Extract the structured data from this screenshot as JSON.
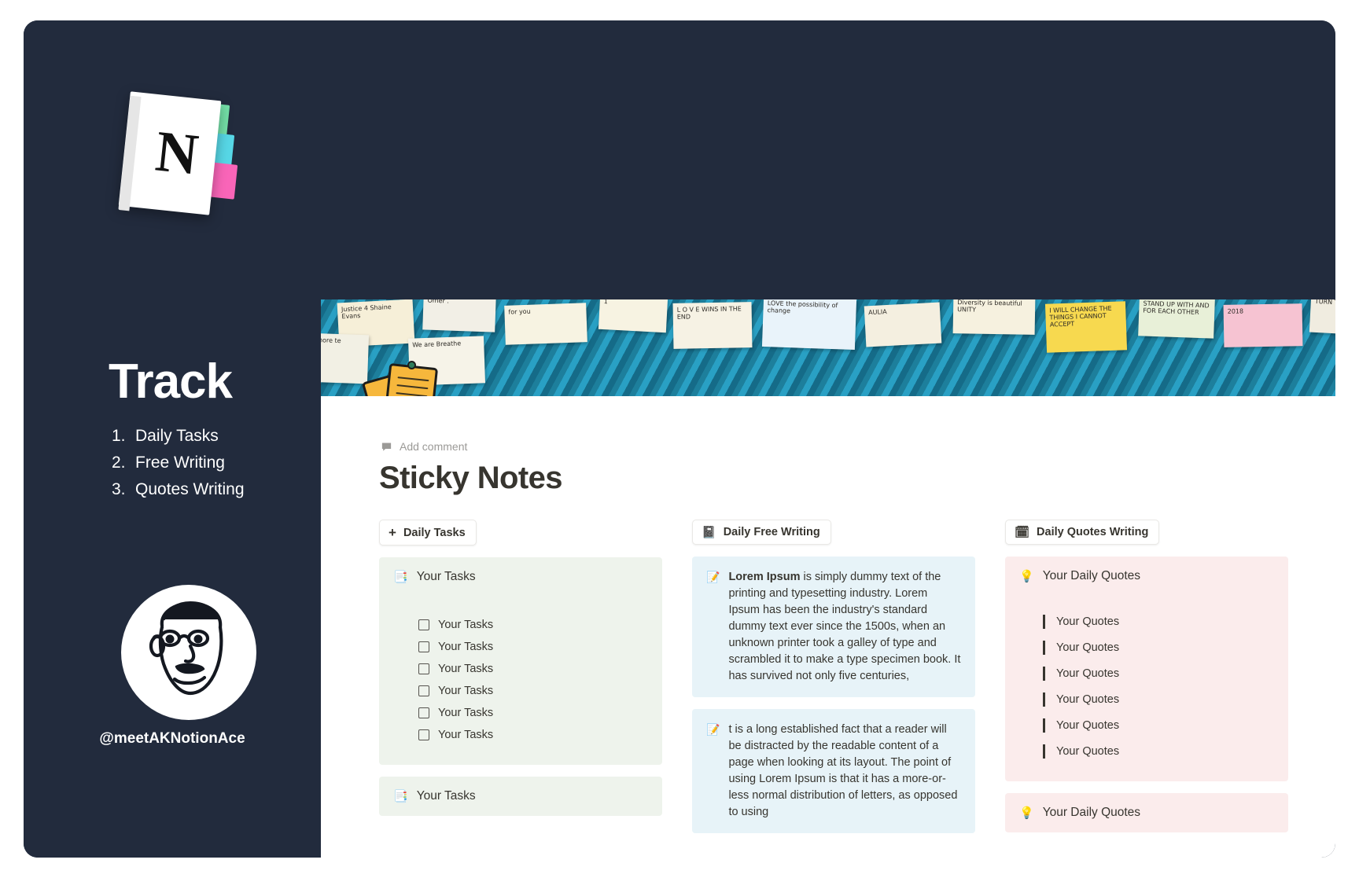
{
  "promo": {
    "logo_name": "notion-notebook-logo",
    "title": "Track",
    "list": [
      {
        "num": "1.",
        "label": "Daily Tasks"
      },
      {
        "num": "2.",
        "label": "Free Writing"
      },
      {
        "num": "3.",
        "label": "Quotes Writing"
      }
    ],
    "handle": "@meetAKNotionAce",
    "bg_color": "#222b3d"
  },
  "notion": {
    "cover_alt": "sticky-notes-wall-photo",
    "cover_notes": [
      {
        "text": "Justice 4 Shaine Evans",
        "color": "#f6efd8"
      },
      {
        "text": "Omer .",
        "color": "#f2efe6"
      },
      {
        "text": "for you",
        "color": "#f7f3e2"
      },
      {
        "text": "1",
        "color": "#f7f3e2"
      },
      {
        "text": "L O V E WINS IN THE END",
        "color": "#f6f2e4"
      },
      {
        "text": "LOVE the possibility of change",
        "color": "#e9f3fa"
      },
      {
        "text": "AULIA",
        "color": "#f4efe0"
      },
      {
        "text": "Diversity is beautiful UNITY",
        "color": "#f6f1df"
      },
      {
        "text": "I WILL CHANGE THE THINGS I CANNOT ACCEPT",
        "color": "#f7d94f"
      },
      {
        "text": "STAND UP WITH AND FOR EACH OTHER",
        "color": "#e8f0d8"
      },
      {
        "text": "2018",
        "color": "#f6c3d2"
      },
      {
        "text": "TURN THE",
        "color": "#f0ece0"
      },
      {
        "text": "Lenore te",
        "color": "#f2f0e4"
      },
      {
        "text": "We are Breathe",
        "color": "#f6f3e8"
      }
    ],
    "add_comment": "Add comment",
    "comment_icon": "comment-icon",
    "title": "Sticky Notes",
    "columns": [
      {
        "id": "daily-tasks",
        "button": {
          "icon": "plus-icon",
          "glyph": "+",
          "label": "Daily Tasks"
        },
        "card_color": "#eef3ec",
        "cards": [
          {
            "icon": "page-with-bullet-icon",
            "glyph": "📑",
            "heading": "Your Tasks",
            "tasks": [
              "Your Tasks",
              "Your Tasks",
              "Your Tasks",
              "Your Tasks",
              "Your Tasks",
              "Your Tasks"
            ]
          },
          {
            "icon": "page-with-bullet-icon",
            "glyph": "📑",
            "heading": "Your Tasks",
            "tasks": []
          }
        ]
      },
      {
        "id": "daily-free-writing",
        "button": {
          "icon": "notepad-icon",
          "glyph": "📓",
          "label": "Daily Free Writing"
        },
        "card_color": "#e7f3f8",
        "paragraphs": [
          {
            "icon": "memo-pencil-icon",
            "glyph": "📝",
            "lead": "Lorem Ipsum",
            "text": " is simply dummy text of the printing and typesetting industry. Lorem Ipsum has been the industry's standard dummy text ever since the 1500s, when an unknown printer took a galley of type and scrambled it to make a type specimen book. It has survived not only five centuries,"
          },
          {
            "icon": "memo-pencil-icon",
            "glyph": "📝",
            "lead": "",
            "text": "t is a long established fact that a reader will be distracted by the readable content of a page when looking at its layout. The point of using Lorem Ipsum is that it has a more-or-less normal distribution of letters, as opposed to using"
          }
        ]
      },
      {
        "id": "daily-quotes-writing",
        "button": {
          "icon": "calendar-table-icon",
          "glyph": "🗓",
          "label": "Daily Quotes Writing"
        },
        "card_color": "#fbecec",
        "cards": [
          {
            "icon": "light-bulb-icon",
            "glyph": "💡",
            "heading": "Your Daily Quotes",
            "quotes": [
              "Your Quotes",
              "Your Quotes",
              "Your Quotes",
              "Your Quotes",
              "Your Quotes",
              "Your Quotes"
            ]
          },
          {
            "icon": "light-bulb-icon",
            "glyph": "💡",
            "heading": "Your Daily Quotes",
            "quotes": []
          }
        ]
      }
    ]
  }
}
